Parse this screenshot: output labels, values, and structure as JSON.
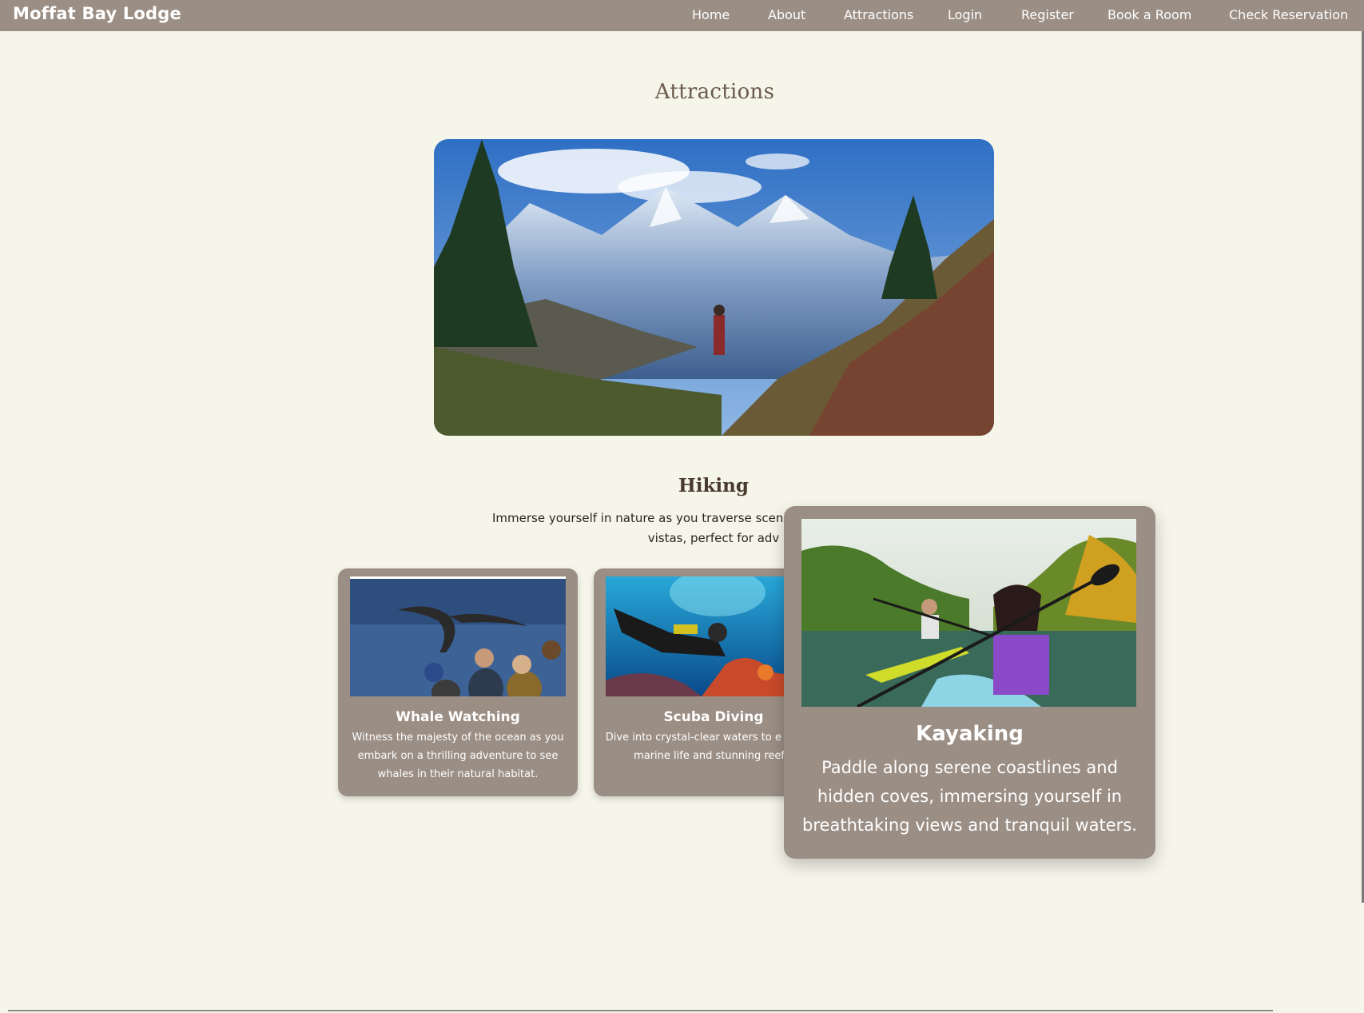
{
  "navbar": {
    "brand": "Moffat Bay Lodge",
    "links": [
      "Home",
      "About",
      "Attractions",
      "Login",
      "Register",
      "Book a Room",
      "Check Reservation"
    ]
  },
  "main": {
    "title": "Attractions",
    "hero": {
      "heading": "Hiking",
      "description": "Immerse yourself in nature as you traverse scenic breathtaking mountain vistas, perfect for adv"
    },
    "cards": [
      {
        "title": "Whale Watching",
        "description": "Witness the majesty of the ocean as you embark on a thrilling adventure to see whales in their natural habitat."
      },
      {
        "title": "Scuba Diving",
        "description": "Dive into crystal-clear waters to e vibrant marine life and stunning reefs."
      },
      {
        "title": "Kayaking",
        "description": "Paddle along serene coastlines and hidden coves, immersing yourself in breathtaking views and tranquil waters."
      }
    ]
  },
  "colors": {
    "nav_bg": "#9b8e84",
    "page_bg": "#f5f5ea",
    "title": "#6b5a4c",
    "card_bg": "#9b8e84"
  }
}
